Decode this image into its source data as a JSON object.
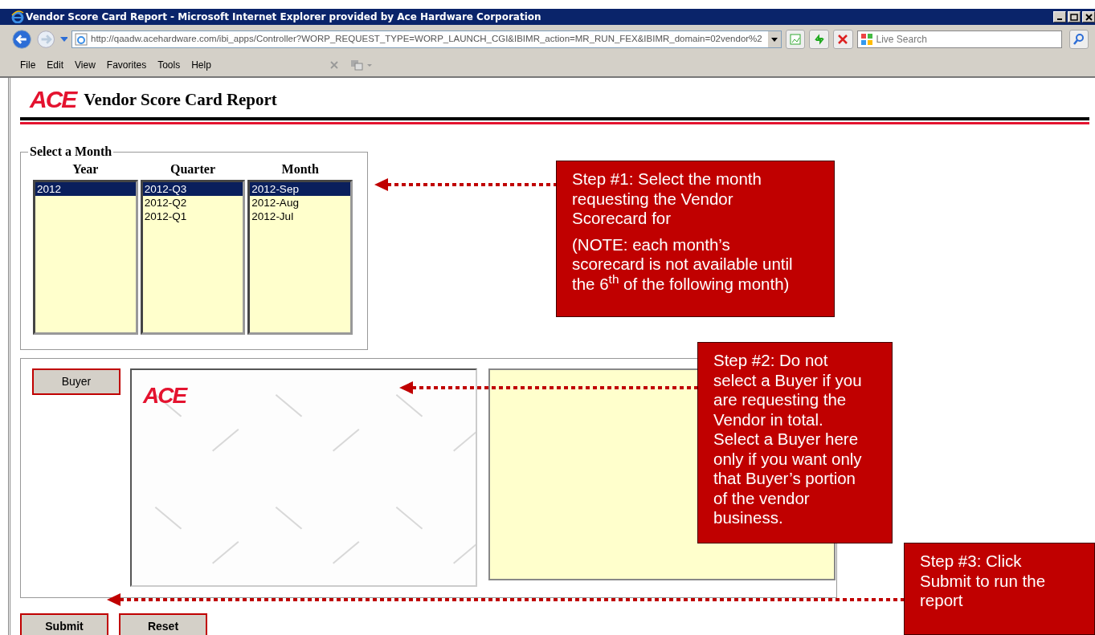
{
  "window": {
    "title": "Vendor Score Card Report - Microsoft Internet Explorer provided by Ace Hardware Corporation"
  },
  "address_bar": {
    "url": "http://qaadw.acehardware.com/ibi_apps/Controller?WORP_REQUEST_TYPE=WORP_LAUNCH_CGI&IBIMR_action=MR_RUN_FEX&IBIMR_domain=02vendor%2"
  },
  "search": {
    "placeholder": "Live Search"
  },
  "menu": [
    "File",
    "Edit",
    "View",
    "Favorites",
    "Tools",
    "Help"
  ],
  "page": {
    "logo": "ACE",
    "title": "Vendor Score Card Report"
  },
  "month_selector": {
    "legend": "Select a Month",
    "lists": [
      {
        "heading": "Year",
        "options": [
          {
            "label": "2012",
            "selected": true
          }
        ]
      },
      {
        "heading": "Quarter",
        "options": [
          {
            "label": "2012-Q3",
            "selected": true
          },
          {
            "label": "2012-Q2",
            "selected": false
          },
          {
            "label": "2012-Q1",
            "selected": false
          }
        ]
      },
      {
        "heading": "Month",
        "options": [
          {
            "label": "2012-Sep",
            "selected": true
          },
          {
            "label": "2012-Aug",
            "selected": false
          },
          {
            "label": "2012-Jul",
            "selected": false
          }
        ]
      }
    ]
  },
  "buyer": {
    "button": "Buyer",
    "panel_logo": "ACE"
  },
  "buttons": [
    "Submit",
    "Reset"
  ],
  "callouts": [
    {
      "paragraphs": [
        "Step #1: Select the month requesting the Vendor Scorecard for",
        "(NOTE: each month’s scorecard is not available until the 6$^{th}$ of the following month)"
      ]
    },
    {
      "paragraphs": [
        "Step #2: Do not select a Buyer if you are requesting the Vendor in total. Select a Buyer here only if you want only that Buyer’s portion of the vendor business."
      ]
    },
    {
      "paragraphs": [
        "Step #3: Click Submit to run the report"
      ]
    }
  ]
}
